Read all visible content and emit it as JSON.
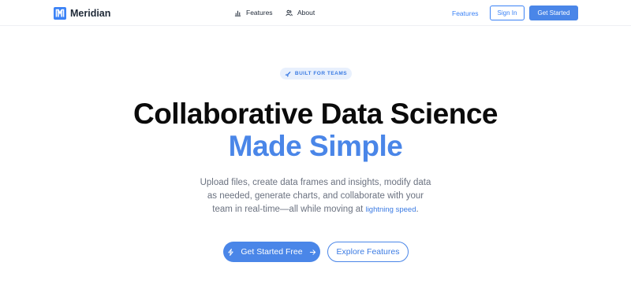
{
  "brand": {
    "name": "Meridian",
    "logo_icon": "meridian-logo-icon",
    "accent": "#4a86e8"
  },
  "nav": {
    "features_label": "Features",
    "features_icon": "chart-icon",
    "about_label": "About",
    "about_icon": "users-icon"
  },
  "header_actions": {
    "features_link": "Features",
    "sign_in": "Sign In",
    "get_started": "Get Started"
  },
  "hero": {
    "badge": "BUILT FOR TEAMS",
    "badge_icon": "rocket-icon",
    "headline_line1": "Collaborative Data Science",
    "headline_line2": "Made Simple",
    "subtitle_part1": "Upload files, create data frames and insights, modify data as needed, generate charts, and collaborate with your team in real-time—all while moving at ",
    "subtitle_highlight": "lightning speed",
    "subtitle_end": ".",
    "cta_primary": "Get Started Free",
    "cta_primary_icon_left": "lightning-icon",
    "cta_primary_icon_right": "arrow-right-icon",
    "cta_secondary": "Explore Features"
  }
}
